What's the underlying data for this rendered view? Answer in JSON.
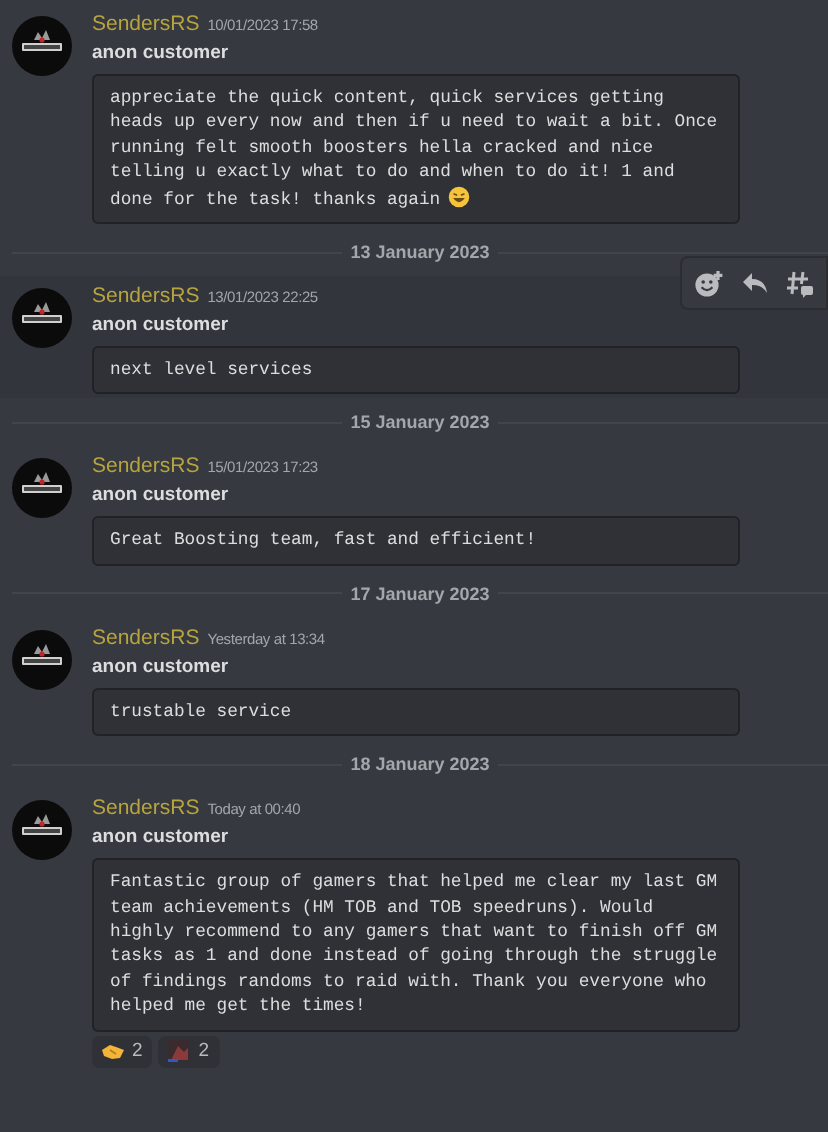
{
  "feed": [
    {
      "kind": "message",
      "author": "SendersRS",
      "timestamp": "10/01/2023 17:58",
      "subtitle": "anon customer",
      "body": "appreciate the quick content, quick services getting heads up every now and then if u need to wait a bit. Once running felt smooth boosters hella cracked and nice telling u exactly what to do and when to do it! 1 and done for the task! thanks again",
      "trailing_emoji": true,
      "hovered": false
    },
    {
      "kind": "divider",
      "label": "13 January 2023"
    },
    {
      "kind": "message",
      "author": "SendersRS",
      "timestamp": "13/01/2023 22:25",
      "subtitle": "anon customer",
      "body": "next level services",
      "trailing_emoji": false,
      "hovered": true
    },
    {
      "kind": "divider",
      "label": "15 January 2023"
    },
    {
      "kind": "message",
      "author": "SendersRS",
      "timestamp": "15/01/2023 17:23",
      "subtitle": "anon customer",
      "body": "Great Boosting team, fast and efficient!",
      "trailing_emoji": false,
      "hovered": false
    },
    {
      "kind": "divider",
      "label": "17 January 2023"
    },
    {
      "kind": "message",
      "author": "SendersRS",
      "timestamp": "Yesterday at 13:34",
      "subtitle": "anon customer",
      "body": "trustable service",
      "trailing_emoji": false,
      "hovered": false
    },
    {
      "kind": "divider",
      "label": "18 January 2023"
    },
    {
      "kind": "message",
      "author": "SendersRS",
      "timestamp": "Today at 00:40",
      "subtitle": "anon customer",
      "body": "Fantastic group of gamers that helped me clear my last GM team achievements (HM TOB and TOB speedruns). Would highly recommend to any gamers that want to finish off GM tasks as 1 and done instead of going through the struggle of findings randoms to raid with. Thank you everyone who helped me get the times!",
      "trailing_emoji": false,
      "hovered": false,
      "reactions": [
        {
          "kind": "handshake",
          "count": "2"
        },
        {
          "kind": "image",
          "count": "2"
        }
      ]
    }
  ]
}
